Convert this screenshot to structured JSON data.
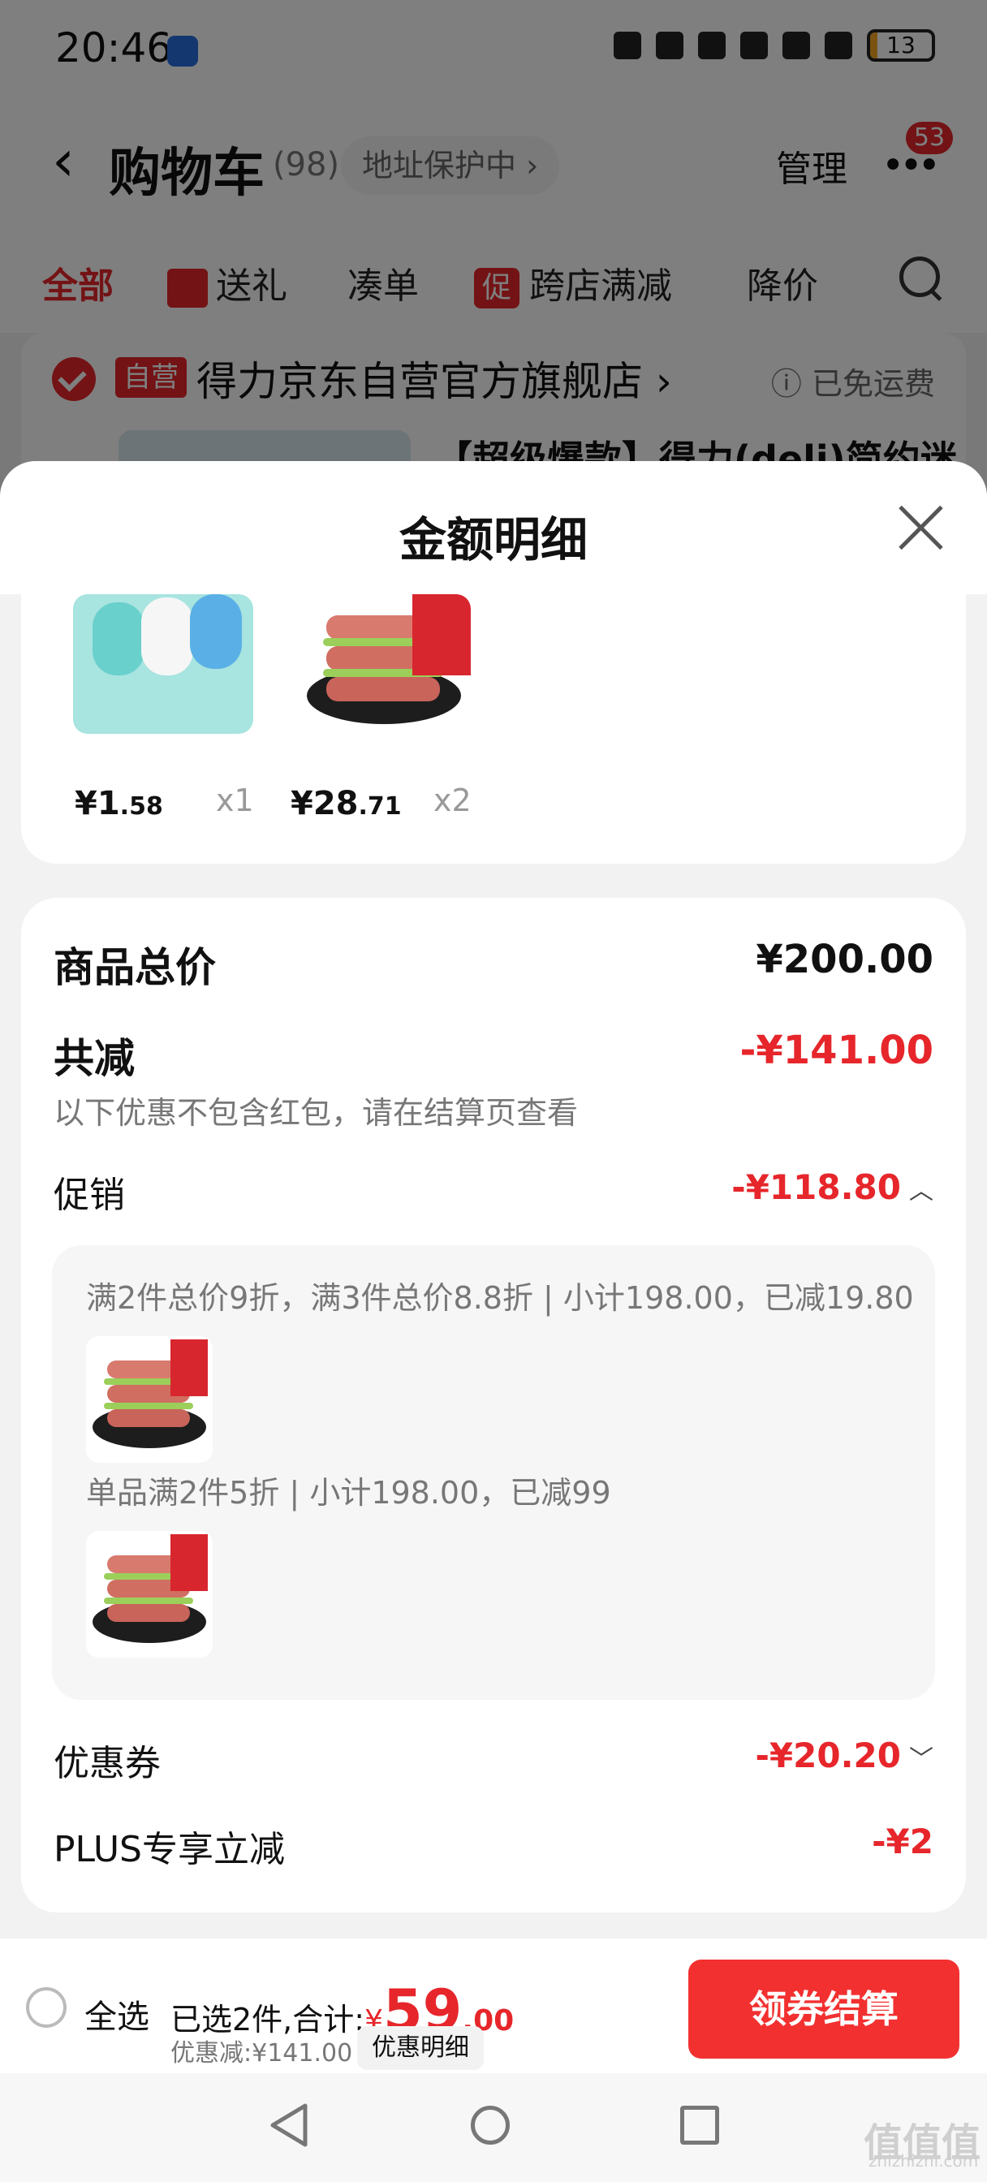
{
  "status_bar": {
    "time": "20:46",
    "battery": "13"
  },
  "cart_header": {
    "title": "购物车",
    "count": "(98)",
    "address_protection": "地址保护中",
    "manage": "管理",
    "message_badge": "53"
  },
  "tabs": [
    "全部",
    "送礼",
    "凑单",
    "跨店满减",
    "降价"
  ],
  "promo_tab_icon": "促",
  "store": {
    "self_tag": "自营",
    "name": "得力京东自营官方旗舰店",
    "free_shipping": "已免运费",
    "product_title": "【超级爆款】得力(deli)简约迷"
  },
  "sheet": {
    "title": "金额明细",
    "items": [
      {
        "price_int": "¥1",
        "price_dec": ".58",
        "qty": "x1"
      },
      {
        "price_int": "¥28",
        "price_dec": ".71",
        "qty": "x2"
      }
    ],
    "summary": {
      "goods_total_label": "商品总价",
      "goods_total_value": "¥200.00",
      "total_reduction_label": "共减",
      "total_reduction_value": "-¥141.00",
      "reduction_note": "以下优惠不包含红包，请在结算页查看",
      "promotion_label": "促销",
      "promotion_value": "-¥118.80",
      "promo_detail_1": "满2件总价9折，满3件总价8.8折 | 小计198.00，已减19.80",
      "promo_detail_2": "单品满2件5折 | 小计198.00，已减99",
      "coupon_label": "优惠券",
      "coupon_value": "-¥20.20",
      "plus_label": "PLUS专享立减",
      "plus_value": "-¥2"
    }
  },
  "bottom_bar": {
    "select_all": "全选",
    "selected_prefix": "已选2件,合计:",
    "total_yen": "¥",
    "total_int": "59",
    "total_dec": ".00",
    "discount": "优惠减:¥141.00",
    "detail_button": "优惠明细",
    "checkout_button": "领券结算"
  },
  "watermark": {
    "main": "值值值",
    "sub": "zhizhizhi.com"
  },
  "colors": {
    "accent_red": "#e6262b",
    "checkout_red": "#f23030"
  }
}
